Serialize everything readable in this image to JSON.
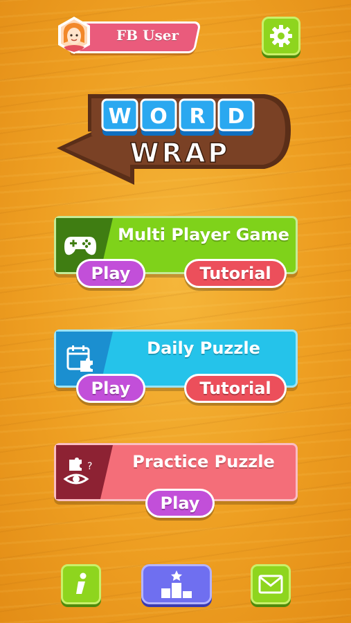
{
  "profile": {
    "name": "FB User",
    "avatar_icon": "user-avatar-icon"
  },
  "settings": {
    "icon": "gear-icon"
  },
  "logo": {
    "line1": [
      "W",
      "O",
      "R",
      "D"
    ],
    "line2": "WRAP"
  },
  "menu": [
    {
      "id": "multi",
      "title": "Multi Player Game",
      "icon": "gamepad-icon",
      "play_label": "Play",
      "tutorial_label": "Tutorial",
      "color": "#7fd21a"
    },
    {
      "id": "daily",
      "title": "Daily Puzzle",
      "icon": "calendar-puzzle-icon",
      "play_label": "Play",
      "tutorial_label": "Tutorial",
      "color": "#25c3ea"
    },
    {
      "id": "practice",
      "title": "Practice Puzzle",
      "icon": "puzzle-eye-icon",
      "play_label": "Play",
      "color": "#f46e79"
    }
  ],
  "bottom_bar": [
    {
      "id": "info",
      "icon": "info-icon"
    },
    {
      "id": "leaderboard",
      "icon": "podium-icon"
    },
    {
      "id": "mail",
      "icon": "mail-icon"
    }
  ]
}
